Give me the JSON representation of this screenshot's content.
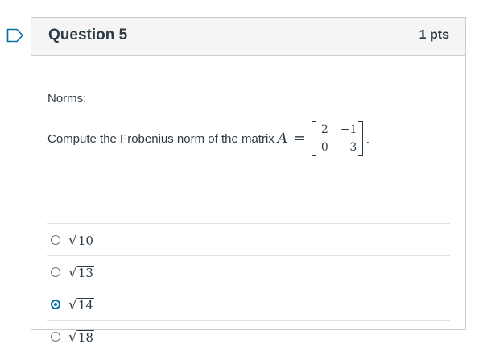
{
  "question": {
    "title": "Question 5",
    "points": "1 pts",
    "topic": "Norms:",
    "prompt": "Compute the Frobenius norm of the matrix",
    "matrix_var": "A",
    "equals": "=",
    "matrix": [
      [
        "2",
        "−1"
      ],
      [
        "0",
        "3"
      ]
    ],
    "period": "."
  },
  "answers": [
    {
      "radicand": "10",
      "selected": false
    },
    {
      "radicand": "13",
      "selected": false
    },
    {
      "radicand": "14",
      "selected": true
    },
    {
      "radicand": "18",
      "selected": false
    }
  ],
  "colors": {
    "accent": "#0770a3",
    "header_bg": "#f5f5f5",
    "border": "#c7cdd1",
    "text": "#2d3b45"
  },
  "icons": {
    "flag": "bookmark-flag-icon",
    "radio": "radio-button-icon",
    "sqrt": "square-root-icon"
  }
}
